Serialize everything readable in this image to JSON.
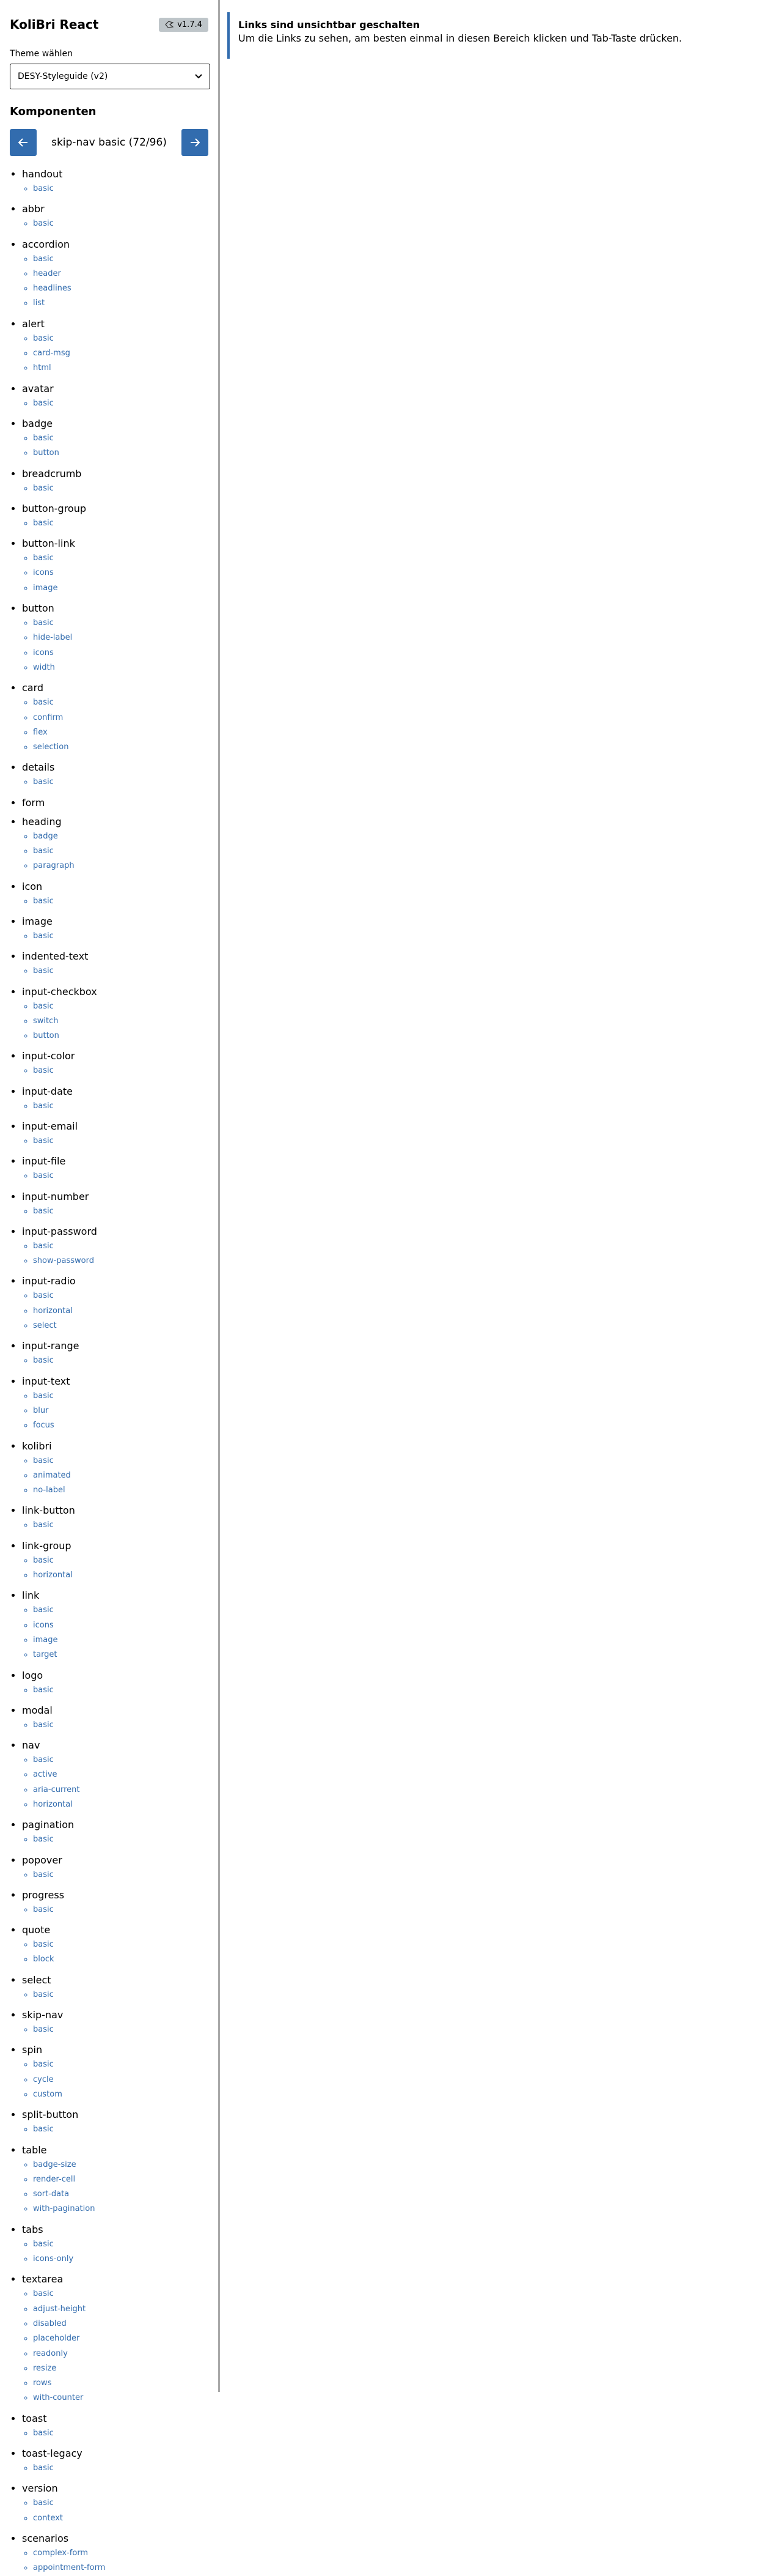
{
  "app": {
    "title": "KoliBri React",
    "version": "v1.7.4",
    "version_icon": "kolibri-logo-icon"
  },
  "theme": {
    "label": "Theme wählen",
    "selected": "DESY-Styleguide (v2)"
  },
  "components": {
    "heading": "Komponenten",
    "pager": {
      "current": "skip-nav basic (72/96)",
      "prev_icon": "arrow-left-icon",
      "next_icon": "arrow-right-icon"
    },
    "items": [
      {
        "name": "handout",
        "subs": [
          "basic"
        ]
      },
      {
        "name": "abbr",
        "subs": [
          "basic"
        ]
      },
      {
        "name": "accordion",
        "subs": [
          "basic",
          "header",
          "headlines",
          "list"
        ]
      },
      {
        "name": "alert",
        "subs": [
          "basic",
          "card-msg",
          "html"
        ]
      },
      {
        "name": "avatar",
        "subs": [
          "basic"
        ]
      },
      {
        "name": "badge",
        "subs": [
          "basic",
          "button"
        ]
      },
      {
        "name": "breadcrumb",
        "subs": [
          "basic"
        ]
      },
      {
        "name": "button-group",
        "subs": [
          "basic"
        ]
      },
      {
        "name": "button-link",
        "subs": [
          "basic",
          "icons",
          "image"
        ]
      },
      {
        "name": "button",
        "subs": [
          "basic",
          "hide-label",
          "icons",
          "width"
        ]
      },
      {
        "name": "card",
        "subs": [
          "basic",
          "confirm",
          "flex",
          "selection"
        ]
      },
      {
        "name": "details",
        "subs": [
          "basic"
        ]
      },
      {
        "name": "form",
        "subs": []
      },
      {
        "name": "heading",
        "subs": [
          "badge",
          "basic",
          "paragraph"
        ]
      },
      {
        "name": "icon",
        "subs": [
          "basic"
        ]
      },
      {
        "name": "image",
        "subs": [
          "basic"
        ]
      },
      {
        "name": "indented-text",
        "subs": [
          "basic"
        ]
      },
      {
        "name": "input-checkbox",
        "subs": [
          "basic",
          "switch",
          "button"
        ]
      },
      {
        "name": "input-color",
        "subs": [
          "basic"
        ]
      },
      {
        "name": "input-date",
        "subs": [
          "basic"
        ]
      },
      {
        "name": "input-email",
        "subs": [
          "basic"
        ]
      },
      {
        "name": "input-file",
        "subs": [
          "basic"
        ]
      },
      {
        "name": "input-number",
        "subs": [
          "basic"
        ]
      },
      {
        "name": "input-password",
        "subs": [
          "basic",
          "show-password"
        ]
      },
      {
        "name": "input-radio",
        "subs": [
          "basic",
          "horizontal",
          "select"
        ]
      },
      {
        "name": "input-range",
        "subs": [
          "basic"
        ]
      },
      {
        "name": "input-text",
        "subs": [
          "basic",
          "blur",
          "focus"
        ]
      },
      {
        "name": "kolibri",
        "subs": [
          "basic",
          "animated",
          "no-label"
        ]
      },
      {
        "name": "link-button",
        "subs": [
          "basic"
        ]
      },
      {
        "name": "link-group",
        "subs": [
          "basic",
          "horizontal"
        ]
      },
      {
        "name": "link",
        "subs": [
          "basic",
          "icons",
          "image",
          "target"
        ]
      },
      {
        "name": "logo",
        "subs": [
          "basic"
        ]
      },
      {
        "name": "modal",
        "subs": [
          "basic"
        ]
      },
      {
        "name": "nav",
        "subs": [
          "basic",
          "active",
          "aria-current",
          "horizontal"
        ]
      },
      {
        "name": "pagination",
        "subs": [
          "basic"
        ]
      },
      {
        "name": "popover",
        "subs": [
          "basic"
        ]
      },
      {
        "name": "progress",
        "subs": [
          "basic"
        ]
      },
      {
        "name": "quote",
        "subs": [
          "basic",
          "block"
        ]
      },
      {
        "name": "select",
        "subs": [
          "basic"
        ]
      },
      {
        "name": "skip-nav",
        "subs": [
          "basic"
        ]
      },
      {
        "name": "spin",
        "subs": [
          "basic",
          "cycle",
          "custom"
        ]
      },
      {
        "name": "split-button",
        "subs": [
          "basic"
        ]
      },
      {
        "name": "table",
        "subs": [
          "badge-size",
          "render-cell",
          "sort-data",
          "with-pagination"
        ]
      },
      {
        "name": "tabs",
        "subs": [
          "basic",
          "icons-only"
        ]
      },
      {
        "name": "textarea",
        "subs": [
          "basic",
          "adjust-height",
          "disabled",
          "placeholder",
          "readonly",
          "resize",
          "rows",
          "with-counter"
        ]
      },
      {
        "name": "toast",
        "subs": [
          "basic"
        ]
      },
      {
        "name": "toast-legacy",
        "subs": [
          "basic"
        ]
      },
      {
        "name": "version",
        "subs": [
          "basic",
          "context"
        ]
      },
      {
        "name": "scenarios",
        "subs": [
          "complex-form",
          "appointment-form"
        ]
      }
    ]
  },
  "notice": {
    "title": "Links sind unsichtbar geschalten",
    "text": "Um die Links zu sehen, am besten einmal in diesen Bereich klicken und Tab-Taste drücken."
  },
  "colors": {
    "accent": "#326cae",
    "badge_bg": "#bec5c9",
    "divider": "#a9a9a9"
  }
}
